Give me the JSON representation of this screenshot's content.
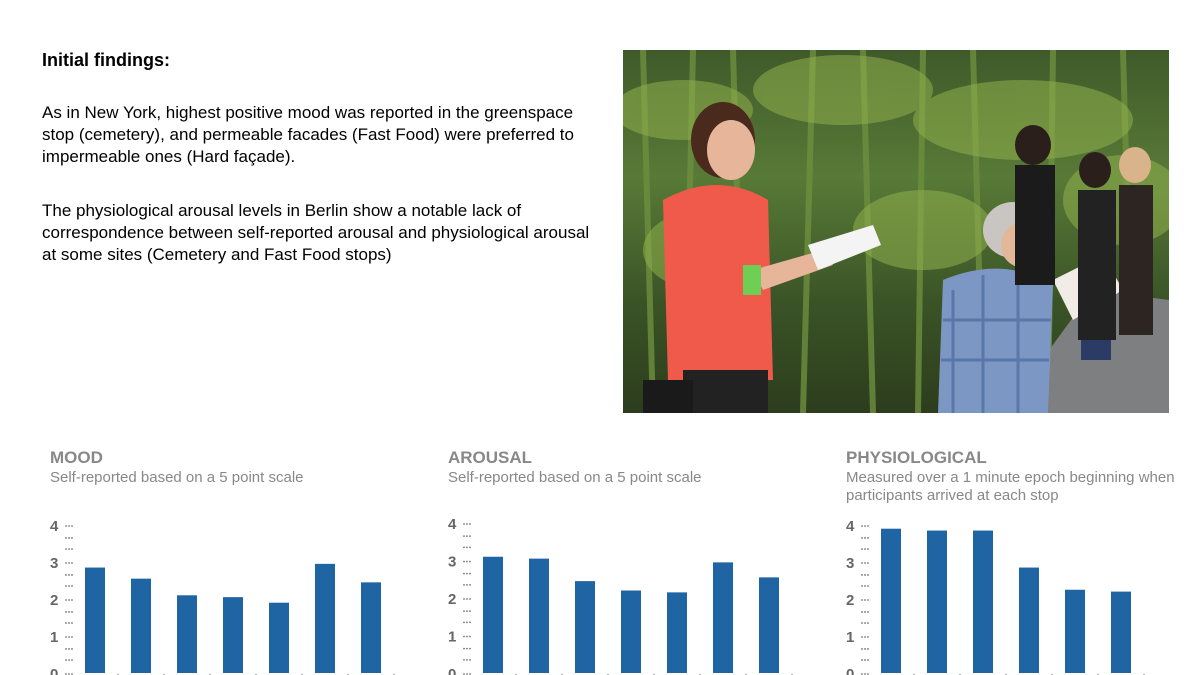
{
  "findings": {
    "heading": "Initial findings:",
    "paragraph1": "As in New York, highest positive mood was reported in the greenspace stop (cemetery), and permeable facades (Fast Food) were preferred to impermeable ones (Hard façade).",
    "paragraph2": "The physiological arousal levels in Berlin show a notable lack of correspondence between self-reported arousal and physiological arousal at some sites (Cemetery and Fast Food stops)"
  },
  "colors": {
    "bar": "#1f65a3",
    "title": "#888888",
    "tick": "#666666"
  },
  "chart_data": [
    {
      "type": "bar",
      "title": "MOOD",
      "subtitle": "Self-reported based on a 5 point scale",
      "xlabel": "",
      "ylabel": "",
      "ylim": [
        0,
        4
      ],
      "yticks": [
        "0",
        "1",
        "2",
        "3",
        "4"
      ],
      "values": [
        2.85,
        2.55,
        2.1,
        2.05,
        1.9,
        2.95,
        2.45
      ],
      "grid": false
    },
    {
      "type": "bar",
      "title": "AROUSAL",
      "subtitle": "Self-reported based on a 5 point scale",
      "xlabel": "",
      "ylabel": "",
      "ylim": [
        0,
        4
      ],
      "yticks": [
        "0",
        "1",
        "2",
        "3",
        "4"
      ],
      "values": [
        3.1,
        3.05,
        2.45,
        2.2,
        2.15,
        2.95,
        2.55
      ],
      "grid": false
    },
    {
      "type": "bar",
      "title": "PHYSIOLOGICAL",
      "subtitle": "Measured over a 1 minute epoch beginning when participants arrived at each stop",
      "xlabel": "",
      "ylabel": "",
      "ylim": [
        0,
        4
      ],
      "yticks": [
        "0",
        "1",
        "2",
        "3",
        "4"
      ],
      "values": [
        3.9,
        3.85,
        3.85,
        2.85,
        2.25,
        2.2
      ],
      "grid": false
    }
  ]
}
